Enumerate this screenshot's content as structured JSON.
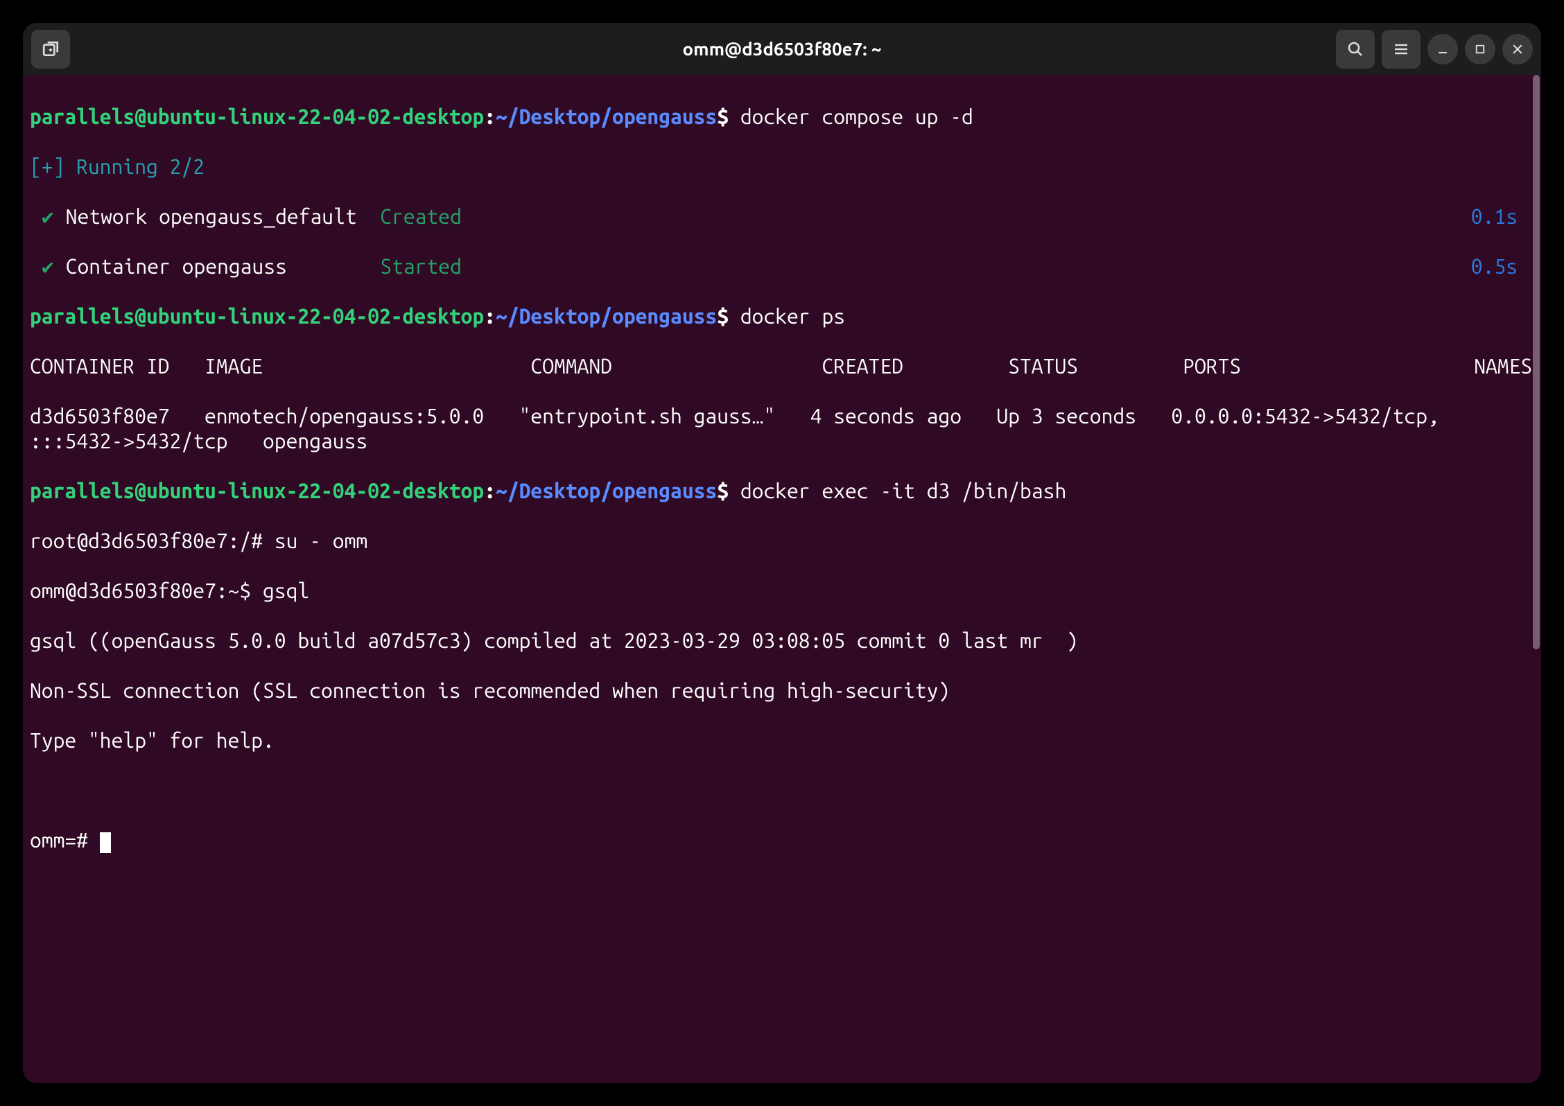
{
  "titlebar": {
    "title": "omm@d3d6503f80e7: ~"
  },
  "prompt": {
    "user_host": "parallels@ubuntu-linux-22-04-02-desktop",
    "cwd": "~/Desktop/opengauss",
    "dollar": "$"
  },
  "cmd1": "docker compose up -d",
  "compose": {
    "running": "[+] Running 2/2",
    "row1_label": " Network opengauss_default  ",
    "row1_status": "Created",
    "row1_time": "0.1s",
    "row2_label": " Container opengauss        ",
    "row2_status": "Started",
    "row2_time": "0.5s"
  },
  "cmd2": "docker ps",
  "ps": {
    "header": "CONTAINER ID   IMAGE                       COMMAND                  CREATED         STATUS         PORTS                    NAMES",
    "row": "d3d6503f80e7   enmotech/opengauss:5.0.0   \"entrypoint.sh gauss…\"   4 seconds ago   Up 3 seconds   0.0.0.0:5432->5432/tcp, :::5432->5432/tcp   opengauss"
  },
  "cmd3": "docker exec -it d3 /bin/bash",
  "shell": {
    "root_prompt": "root@d3d6503f80e7:/# ",
    "root_cmd": "su - omm",
    "omm_prompt": "omm@d3d6503f80e7:~$ ",
    "omm_cmd": "gsql"
  },
  "gsql": {
    "banner1": "gsql ((openGauss 5.0.0 build a07d57c3) compiled at 2023-03-29 03:08:05 commit 0 last mr  )",
    "banner2": "Non-SSL connection (SSL connection is recommended when requiring high-security)",
    "banner3": "Type \"help\" for help.",
    "prompt": "omm=# "
  },
  "checkmark": "✔"
}
